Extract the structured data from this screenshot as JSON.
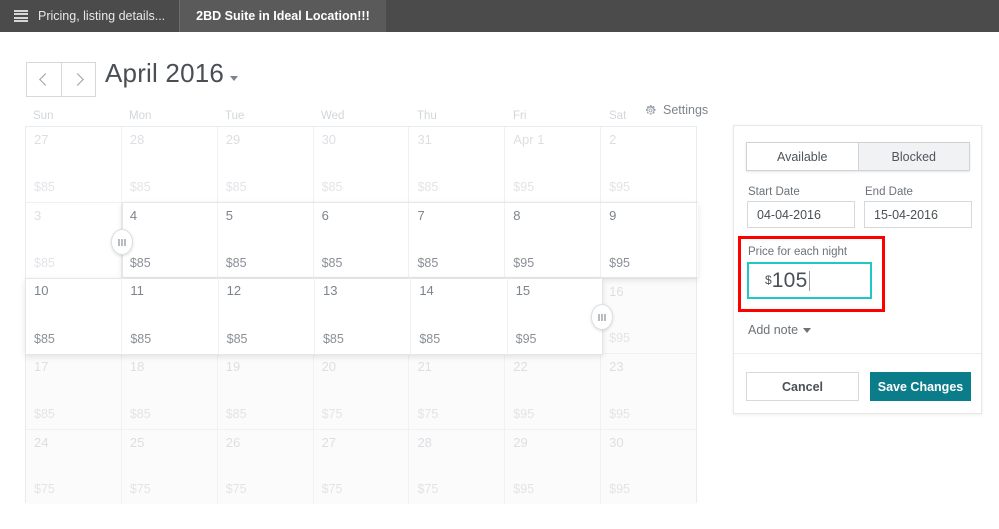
{
  "topbar": {
    "menu_icon": "hamburger-icon",
    "tabs": [
      {
        "label": "Pricing, listing details...",
        "active": false
      },
      {
        "label": "2BD Suite in Ideal Location!!!",
        "active": true
      }
    ]
  },
  "calendar_header": {
    "prev_icon": "chevron-left-icon",
    "next_icon": "chevron-right-icon",
    "month_title": "April 2016",
    "month_caret_icon": "chevron-down-icon",
    "settings_label": "Settings",
    "settings_icon": "gear-icon"
  },
  "weekdays": [
    "Sun",
    "Mon",
    "Tue",
    "Wed",
    "Thu",
    "Fri",
    "Sat"
  ],
  "weeks": [
    [
      {
        "day": "27",
        "price": "$85",
        "state": "out"
      },
      {
        "day": "28",
        "price": "$85",
        "state": "out"
      },
      {
        "day": "29",
        "price": "$85",
        "state": "out"
      },
      {
        "day": "30",
        "price": "$85",
        "state": "out"
      },
      {
        "day": "31",
        "price": "$85",
        "state": "out"
      },
      {
        "day": "Apr 1",
        "price": "$95",
        "state": "out"
      },
      {
        "day": "2",
        "price": "$95",
        "state": "out"
      }
    ],
    [
      {
        "day": "3",
        "price": "$85",
        "state": "out"
      },
      {
        "day": "4",
        "price": "$85",
        "state": "selected"
      },
      {
        "day": "5",
        "price": "$85",
        "state": "selected"
      },
      {
        "day": "6",
        "price": "$85",
        "state": "selected"
      },
      {
        "day": "7",
        "price": "$85",
        "state": "selected"
      },
      {
        "day": "8",
        "price": "$95",
        "state": "selected"
      },
      {
        "day": "9",
        "price": "$95",
        "state": "selected"
      }
    ],
    [
      {
        "day": "10",
        "price": "$85",
        "state": "selected"
      },
      {
        "day": "11",
        "price": "$85",
        "state": "selected"
      },
      {
        "day": "12",
        "price": "$85",
        "state": "selected"
      },
      {
        "day": "13",
        "price": "$85",
        "state": "selected"
      },
      {
        "day": "14",
        "price": "$85",
        "state": "selected"
      },
      {
        "day": "15",
        "price": "$95",
        "state": "selected"
      },
      {
        "day": "16",
        "price": "$95",
        "state": "dim"
      }
    ],
    [
      {
        "day": "17",
        "price": "$85",
        "state": "dim"
      },
      {
        "day": "18",
        "price": "$85",
        "state": "dim"
      },
      {
        "day": "19",
        "price": "$85",
        "state": "dim"
      },
      {
        "day": "20",
        "price": "$75",
        "state": "dim"
      },
      {
        "day": "21",
        "price": "$75",
        "state": "dim"
      },
      {
        "day": "22",
        "price": "$95",
        "state": "dim"
      },
      {
        "day": "23",
        "price": "$95",
        "state": "dim"
      }
    ],
    [
      {
        "day": "24",
        "price": "$75",
        "state": "dim"
      },
      {
        "day": "25",
        "price": "$75",
        "state": "dim"
      },
      {
        "day": "26",
        "price": "$75",
        "state": "dim"
      },
      {
        "day": "27",
        "price": "$75",
        "state": "dim"
      },
      {
        "day": "28",
        "price": "$75",
        "state": "dim"
      },
      {
        "day": "29",
        "price": "$95",
        "state": "dim"
      },
      {
        "day": "30",
        "price": "$95",
        "state": "dim"
      }
    ]
  ],
  "selection": {
    "start_handle_icon": "drag-handle-icon",
    "end_handle_icon": "drag-handle-icon"
  },
  "panel": {
    "availability": {
      "available_label": "Available",
      "blocked_label": "Blocked",
      "selected": "Available"
    },
    "start_date_label": "Start Date",
    "start_date_value": "04-04-2016",
    "end_date_label": "End Date",
    "end_date_value": "15-04-2016",
    "price_label": "Price for each night",
    "price_currency": "$",
    "price_value": "105",
    "add_note_label": "Add note",
    "add_note_caret_icon": "chevron-down-icon",
    "cancel_label": "Cancel",
    "save_label": "Save Changes"
  },
  "colors": {
    "topbar_bg": "#4b4b4b",
    "accent_teal": "#0b7c8a",
    "focus_teal": "#1ec8c8",
    "annotation_red": "#fe0000"
  }
}
